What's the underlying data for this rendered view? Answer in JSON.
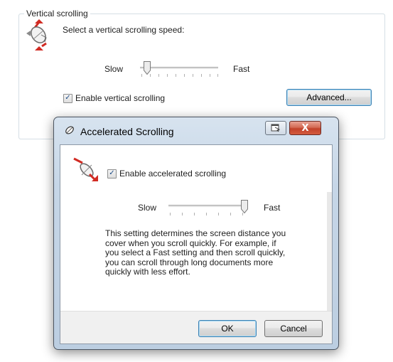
{
  "group": {
    "legend": "Vertical scrolling",
    "select_label": "Select a vertical scrolling speed:",
    "slow_label": "Slow",
    "fast_label": "Fast",
    "speed_level": 0.05,
    "enable_label": "Enable vertical scrolling",
    "enable_checked": true,
    "advanced_button": "Advanced..."
  },
  "dialog": {
    "title": "Accelerated Scrolling",
    "enable_label": "Enable accelerated scrolling",
    "enable_checked": true,
    "slow_label": "Slow",
    "fast_label": "Fast",
    "acceleration_level": 1.0,
    "description": "This setting determines the screen distance you cover when you scroll quickly.  For example, if you select a Fast setting and then scroll quickly, you can scroll through long documents more quickly with less effort.",
    "ok_button": "OK",
    "cancel_button": "Cancel",
    "close_glyph": "X"
  },
  "colors": {
    "accent_red": "#c6242b",
    "dialog_frame": "#c6d6e7",
    "close_button": "#c2422b"
  }
}
